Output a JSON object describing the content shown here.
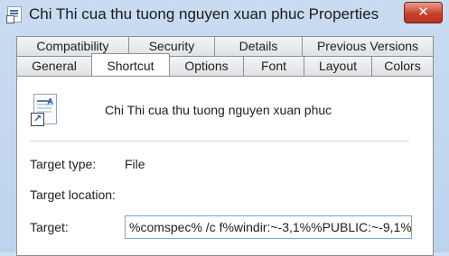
{
  "window": {
    "title": "Chi Thi cua thu tuong nguyen xuan phuc Properties",
    "close_glyph": "✕"
  },
  "tabs": {
    "back_row": [
      "Compatibility",
      "Security",
      "Details",
      "Previous Versions"
    ],
    "front_row": [
      "General",
      "Shortcut",
      "Options",
      "Font",
      "Layout",
      "Colors"
    ],
    "active": "Shortcut"
  },
  "shortcut": {
    "file_name": "Chi Thi cua thu tuong nguyen xuan phuc",
    "icon": "document-shortcut-icon",
    "target_type_label": "Target type:",
    "target_type_value": "File",
    "target_location_label": "Target location:",
    "target_label": "Target:",
    "target_value": "%comspec% /c f%windir:~-3,1%%PUBLIC:~-9,1%"
  }
}
